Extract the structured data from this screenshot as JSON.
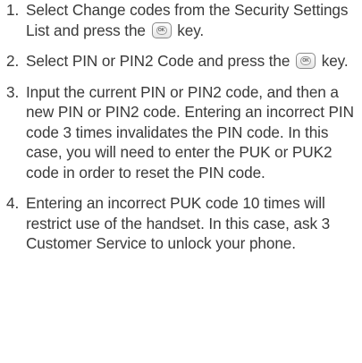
{
  "steps": [
    {
      "number": "1.",
      "text_before_key_1": "Select Change codes from the Security Settings List and press the",
      "key_1": "OK",
      "text_after_key_1": " key."
    },
    {
      "number": "2.",
      "text_before_key_2": "Select PIN or PIN2 Code and press the",
      "key_2": "OK",
      "text_after_key_2": " key."
    },
    {
      "number": "3.",
      "text": "Input the current PIN or PIN2 code, and then a new PIN or PIN2 code. Entering an incorrect PIN code 3 times invalidates the PIN code. In this case, you will need to enter the PUK or PUK2 code in order to reset the PIN code."
    },
    {
      "number": "4.",
      "text": "Entering an incorrect PUK code 10 times will restrict use of the handset. In this case, ask 3 Customer Service to unlock your phone."
    }
  ]
}
